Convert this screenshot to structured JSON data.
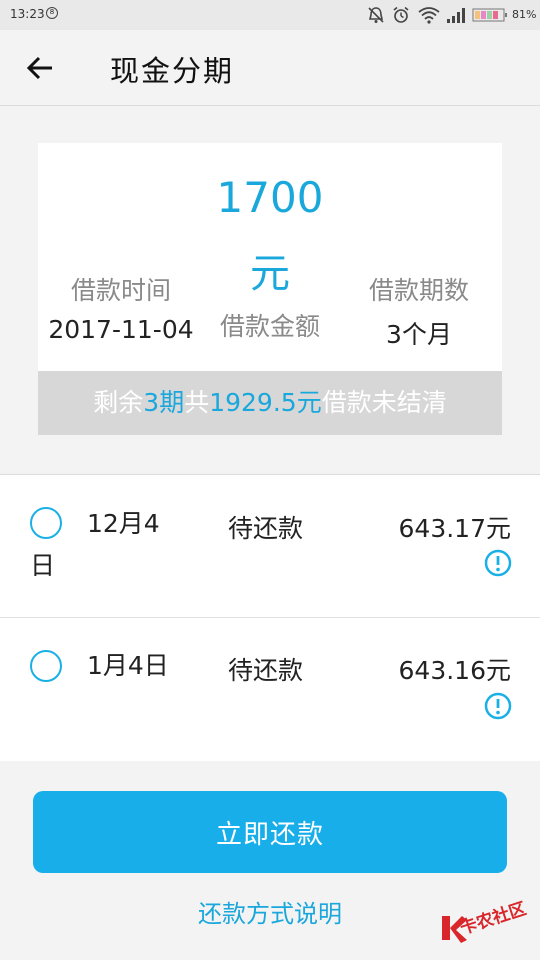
{
  "status_bar": {
    "time": "13:23",
    "notification_glyph": "8",
    "battery": "81%"
  },
  "header": {
    "title": "现金分期",
    "back_icon": "arrow-left-icon"
  },
  "summary": {
    "amount_value": "1700",
    "amount_unit": "元",
    "amount_label": "借款金额",
    "date_label": "借款时间",
    "date_value": "2017-11-04",
    "term_label": "借款期数",
    "term_value": "3个月"
  },
  "banner": {
    "prefix": "剩余",
    "periods": "3期",
    "mid": "共",
    "total": "1929.5元",
    "suffix": "借款未结清"
  },
  "installments": [
    {
      "date_line1": "12月4",
      "date_line2": "日",
      "status": "待还款",
      "amount": "643.17元"
    },
    {
      "date_line1": "1月4日",
      "date_line2": "",
      "status": "待还款",
      "amount": "643.16元"
    }
  ],
  "actions": {
    "pay_now": "立即还款",
    "repay_method_link": "还款方式说明"
  },
  "watermark": {
    "text": "卡农社区"
  },
  "colors": {
    "accent": "#1aa7dc",
    "button": "#18aeea",
    "banner_bg": "#d7d7d7"
  }
}
